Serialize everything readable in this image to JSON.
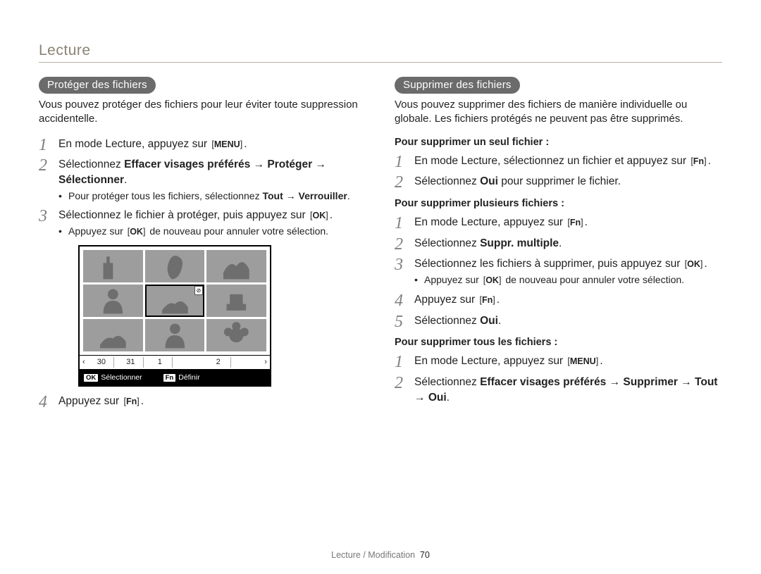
{
  "section": "Lecture",
  "footer": {
    "text": "Lecture / Modification",
    "page": "70"
  },
  "btns": {
    "menu": "MENU",
    "ok": "OK",
    "fn": "Fn"
  },
  "protect": {
    "title": "Protéger des fichiers",
    "intro": "Vous pouvez protéger des fichiers pour leur éviter toute suppression accidentelle.",
    "s1a": "En mode Lecture, appuyez sur ",
    "s2a": "Sélectionnez ",
    "s2b": "Effacer visages préférés",
    "s2arrow1": " → ",
    "s2c": "Protéger",
    "s2arrow2": " → ",
    "s2d": "Sélectionner",
    "s2e": ".",
    "s2_b1a": "Pour protéger tous les fichiers, sélectionnez ",
    "s2_b1b": "Tout",
    "s2_b1arrow": " → ",
    "s2_b1c": "Verrouiller",
    "s2_b1d": ".",
    "s3a": "Sélectionnez le fichier à protéger, puis appuyez sur ",
    "s3_b1a": "Appuyez sur ",
    "s3_b1b": " de nouveau pour annuler votre sélection.",
    "s4a": "Appuyez sur "
  },
  "screen": {
    "cal_left": "‹",
    "cal_cells": [
      "30",
      "31",
      "1",
      "",
      "2",
      ""
    ],
    "cal_right": "›",
    "bb_ok": "OK",
    "bb_ok_label": "Sélectionner",
    "bb_fn": "Fn",
    "bb_fn_label": "Définir",
    "lock": "⊘"
  },
  "delete": {
    "title": "Supprimer des fichiers",
    "intro": "Vous pouvez supprimer des fichiers de manière individuelle ou globale. Les fichiers protégés ne peuvent pas être supprimés.",
    "single_heading": "Pour supprimer un seul fichier :",
    "single_s1a": "En mode Lecture, sélectionnez un fichier et appuyez sur ",
    "single_s2a": "Sélectionnez ",
    "single_s2b": "Oui",
    "single_s2c": " pour supprimer le fichier.",
    "multi_heading": "Pour supprimer plusieurs fichiers :",
    "multi_s1a": "En mode Lecture, appuyez sur ",
    "multi_s2a": "Sélectionnez ",
    "multi_s2b": "Suppr. multiple",
    "multi_s2c": ".",
    "multi_s3a": "Sélectionnez les fichiers à supprimer, puis appuyez sur ",
    "multi_s3_b1a": "Appuyez sur ",
    "multi_s3_b1b": " de nouveau pour annuler votre sélection.",
    "multi_s4a": "Appuyez sur ",
    "multi_s5a": "Sélectionnez ",
    "multi_s5b": "Oui",
    "multi_s5c": ".",
    "all_heading": "Pour supprimer tous les fichiers :",
    "all_s1a": "En mode Lecture, appuyez sur ",
    "all_s2a": "Sélectionnez ",
    "all_s2b": "Effacer visages préférés",
    "all_s2arrow1": " → ",
    "all_s2c": "Supprimer",
    "all_s2arrow2": " → ",
    "all_s2d": "Tout",
    "all_s2arrow3": " → ",
    "all_s2e": "Oui",
    "all_s2f": "."
  }
}
